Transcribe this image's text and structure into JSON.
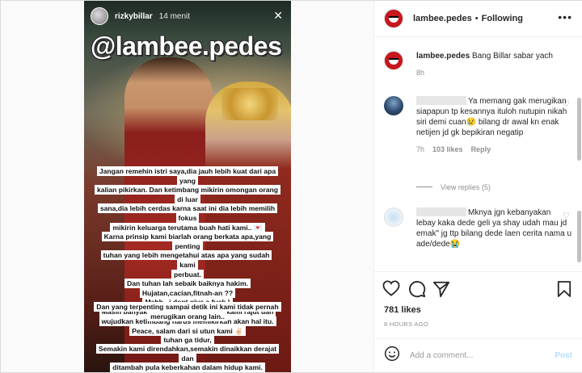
{
  "story": {
    "username": "rizkybillar",
    "time": "14 menit",
    "watermark": "@lambee.pedes",
    "lines": [
      "Jangan remehin istri saya,dia jauh lebih kuat dari apa yang",
      "kalian pikirkan.  Dan ketimbang mikirin omongan orang di luar",
      "sana,dia lebih cerdas karna saat ini dia lebih memilih fokus",
      "mikirin keluarga terutama buah hati kami.. 💌",
      "Karna prinsip kami biarlah orang berkata apa,yang penting",
      "tuhan yang lebih mengetahui atas apa yang sudah kami",
      "perbuat.",
      "Dan tuhan lah sebaik baiknya hakim.",
      "Hujatan,cacian,fitnah-an ??",
      "Mehh...i dont give a fuck !",
      "Masih banyak mimpi2 yang berusaha kami rajut dan",
      "wujudkan  ketimbang harus memikirkan  akan hal itu.  Toh",
      "tuhan ga tidur,",
      "Semakin kami direndahkan,semakin dinaikkan derajat dan",
      "ditambah pula keberkahan dalam hidup kami.",
      "Dan yang terpenting sampai detik ini kami tidak pernah",
      "merugikan orang lain..",
      "Peace, salam dari si utun kami ✌🏻"
    ]
  },
  "header": {
    "account": "lambee.pedes",
    "separator": "•",
    "follow_state": "Following",
    "more": "•••"
  },
  "comments": [
    {
      "user": "lambee.pedes",
      "text": "Bang Billar sabar yach",
      "time": "8h"
    },
    {
      "user": "",
      "text": "Ya memang gak merugikan siapapun tp kesannya ituloh nutupin nikah siri demi cuan😢 bilang dr awal kn enak netijen jd gk bepikiran negatip",
      "time": "7h",
      "likes": "103 likes",
      "reply": "Reply",
      "view_replies": "View replies (5)"
    },
    {
      "user": "",
      "text": "Mknya jgn kebanyakan lebay kaka dede geli ya shay udah mau jd emak\" jg ttp bilang dede laen cerita nama u ade/dede😭"
    }
  ],
  "likes": "781 likes",
  "posted_ago": "8 HOURS AGO",
  "add_comment": {
    "placeholder": "Add a comment...",
    "post_label": "Post"
  },
  "icons": {
    "close": "✕",
    "like": "heart-icon",
    "comment": "comment-icon",
    "share": "share-icon",
    "save": "bookmark-icon",
    "emoji": "emoji-icon",
    "small_heart": "♡"
  },
  "colors": {
    "accent": "#0095f6",
    "post_disabled": "#b2dffc",
    "brand_logo": "#c8161d"
  }
}
